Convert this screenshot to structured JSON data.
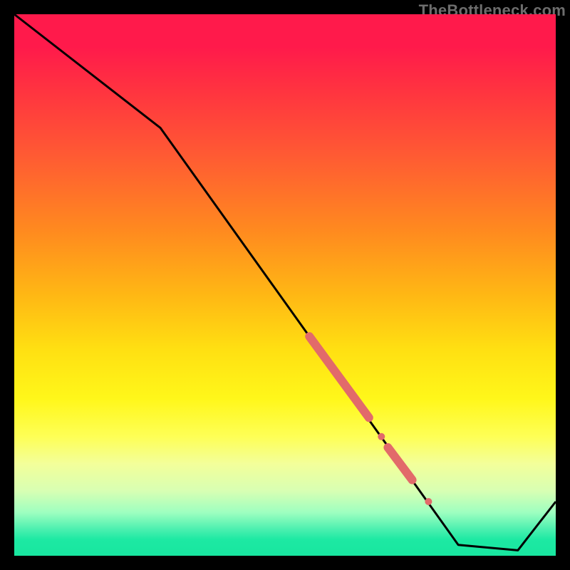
{
  "watermark": "TheBottleneck.com",
  "chart_data": {
    "type": "line",
    "title": "",
    "xlabel": "",
    "ylabel": "",
    "xlim": [
      0,
      100
    ],
    "ylim": [
      0,
      100
    ],
    "series": [
      {
        "name": "bottleneck-curve",
        "points": [
          {
            "x": 0,
            "y": 100
          },
          {
            "x": 27,
            "y": 79
          },
          {
            "x": 82,
            "y": 2
          },
          {
            "x": 93,
            "y": 1
          },
          {
            "x": 100,
            "y": 10
          }
        ],
        "color": "#000000",
        "stroke_width": 3
      }
    ],
    "markers": [
      {
        "name": "thick-segment-1",
        "shape": "segment",
        "x1": 54.5,
        "y1": 40.5,
        "x2": 65.5,
        "y2": 25.5,
        "width": 12,
        "color": "#e26a6a"
      },
      {
        "name": "dot-1",
        "shape": "dot",
        "x": 67.8,
        "y": 22.0,
        "r": 5,
        "color": "#e26a6a"
      },
      {
        "name": "thick-segment-2",
        "shape": "segment",
        "x1": 69.0,
        "y1": 20.0,
        "x2": 73.5,
        "y2": 14.0,
        "width": 12,
        "color": "#e26a6a"
      },
      {
        "name": "dot-2",
        "shape": "dot",
        "x": 76.5,
        "y": 10.0,
        "r": 5,
        "color": "#e26a6a"
      }
    ],
    "notes": "Axes have no visible ticks or labels; background is a vertical red→yellow→green gradient; plot framed by black border."
  }
}
